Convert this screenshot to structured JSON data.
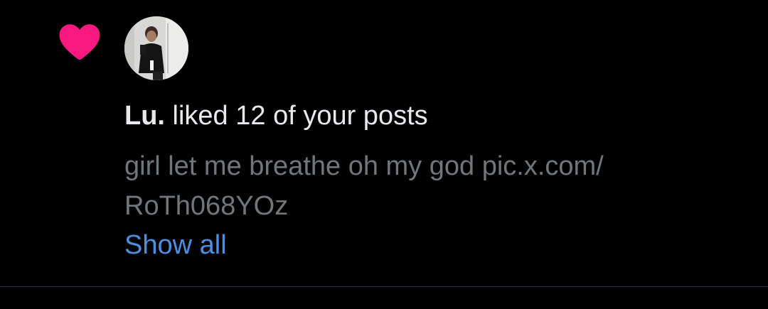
{
  "notification": {
    "user_name": "Lu.",
    "action_text": " liked 12 of your posts",
    "post_text_line1": "girl let me breathe oh my god pic.x.com/",
    "post_text_line2": "RoTh068YOz",
    "show_all_label": "Show all",
    "heart_icon": "heart-icon",
    "colors": {
      "heart": "#f91880",
      "link": "#4a90e2",
      "secondary_text": "#71767b",
      "primary_text": "#e7e9ea",
      "background": "#000000"
    }
  }
}
